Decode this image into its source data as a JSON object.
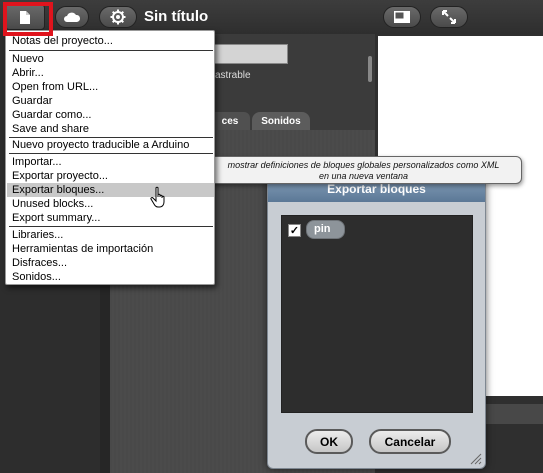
{
  "toolbar": {
    "project_title": "Sin título",
    "file_icon": "file-icon",
    "cloud_icon": "cloud-icon",
    "settings_icon": "gear-icon",
    "stage_size_icon": "stage-size-icon",
    "fullscreen_icon": "fullscreen-icon"
  },
  "file_menu": {
    "items": [
      "Notas del proyecto...",
      "Nuevo",
      "Abrir...",
      "Open from URL...",
      "Guardar",
      "Guardar como...",
      "Save and share",
      "Nuevo proyecto traducible a Arduino",
      "Importar...",
      "Exportar proyecto...",
      "Exportar bloques...",
      "Unused blocks...",
      "Export summary...",
      "Libraries...",
      "Herramientas de importación",
      "Disfraces...",
      "Sonidos..."
    ],
    "highlighted_item": "Exportar bloques..."
  },
  "tooltip": {
    "line1": "mostrar definiciones de bloques globales personalizados como XML",
    "line2": "en una nueva ventana"
  },
  "sprite_corral": {
    "draggable_label": "astrable"
  },
  "tabs": {
    "costumes": "ces",
    "sounds": "Sonidos"
  },
  "export_dialog": {
    "title": "Exportar bloques",
    "blocks": [
      {
        "name": "pin",
        "checked": true,
        "check_glyph": "✓"
      }
    ],
    "ok_label": "OK",
    "cancel_label": "Cancelar"
  },
  "colors": {
    "highlight_frame": "#e0141d",
    "dialog_title_bar": "#6b88a6",
    "menu_highlight": "#c8c8c8"
  }
}
